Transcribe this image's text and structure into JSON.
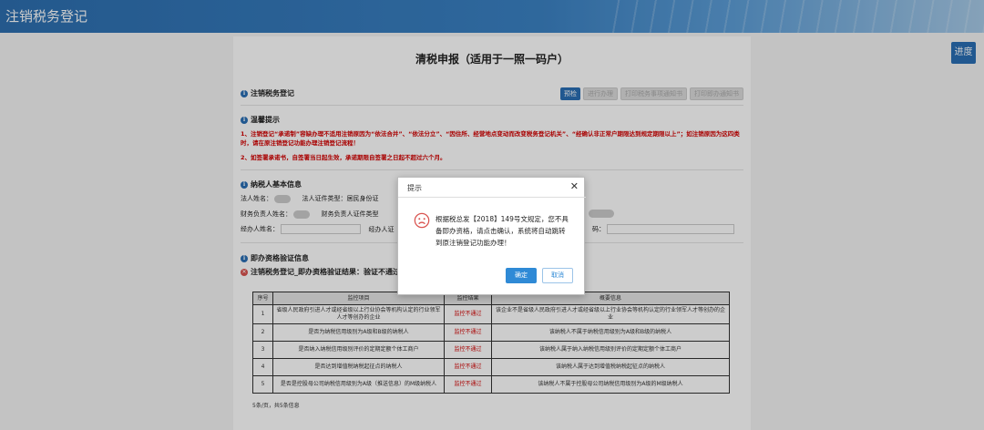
{
  "header": {
    "title": "注销税务登记"
  },
  "progress_button": "进度",
  "page": {
    "title": "清税申报（适用于一照一码户）",
    "section_deregister": "注销税务登记",
    "buttons": {
      "precheck": "预检",
      "b2": "进行办理",
      "b3": "打印税务事项通知书",
      "b4": "打印即办通知书"
    },
    "section_tips": "温馨提示",
    "tip1": "1、注销登记“承诺制”容缺办理不适用注销原因为“依法合并”、“依法分立”、“因住所、经营地点变动而改变税务登记机关”、“经确认非正常户期限达到规定期限以上”；如注销原因为这四类时，请在原注销登记功能办理注销登记流程！",
    "tip2": "2、如签署承诺书，自签署当日起生效，承诺期限自签署之日起不超过六个月。",
    "section_basic": "纳税人基本信息",
    "legal_name": "法人姓名：",
    "legal_id_type": "法人证件类型：居民身份证",
    "finance_name": "财务负责人姓名：",
    "finance_id_type": "财务负责人证件类型",
    "agent_name": "经办人姓名：",
    "agent_id": "经办人证",
    "code_label": "码：",
    "section_verify": "即办资格验证信息",
    "verify_result": "注销税务登记_即办资格验证结果：验证不通过"
  },
  "table": {
    "headers": [
      "序号",
      "监控项目",
      "监控结果",
      "概要信息"
    ],
    "rows": [
      [
        "1",
        "省级人民政府引进人才或经省级以上行业协会等机构认定的行业领军人才等创办的企业",
        "监控不通过",
        "该企业不是省级人民政府引进人才或经省级以上行业协会等机构认定的行业领军人才等创办的企业"
      ],
      [
        "2",
        "是否为纳税信用级别为A级和B级的纳税人",
        "监控不通过",
        "该纳税人不属于纳税信用级别为A级和B级的纳税人"
      ],
      [
        "3",
        "是否纳入纳税信用级别评价的定期定额个体工商户",
        "监控不通过",
        "该纳税人属于纳入纳税信用级别评价的定期定额个体工商户"
      ],
      [
        "4",
        "是否达到增值税纳税起征点的纳税人",
        "监控不通过",
        "该纳税人属于达到增值税纳税起征点的纳税人"
      ],
      [
        "5",
        "是否是控股母公司纳税信用级别为A级（推送信息）的M级纳税人",
        "监控不通过",
        "该纳税人不属于控股母公司纳税信用级别为A级的M级纳税人"
      ]
    ],
    "footer": "5条/页，共5条信息"
  },
  "dialog": {
    "title": "提示",
    "message": "根据税总发【2018】149号文规定，您不具备即办资格，请点击确认，系统将自动跳转到原注销登记功能办理！",
    "ok": "确定",
    "cancel": "取消"
  }
}
